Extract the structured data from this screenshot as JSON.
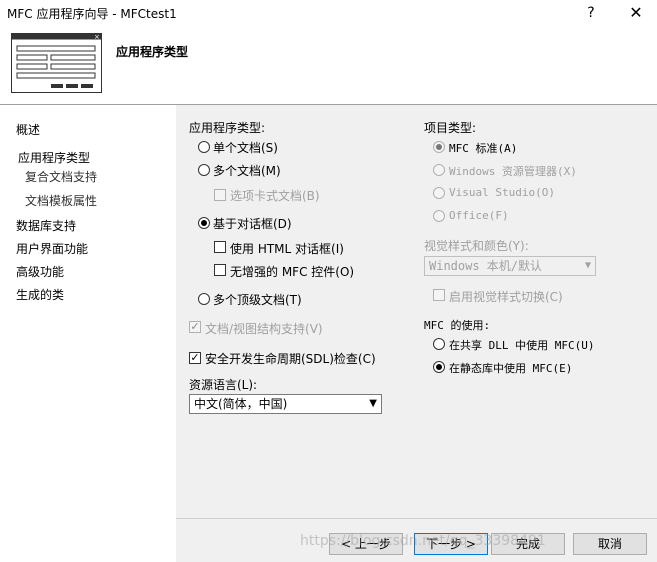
{
  "window": {
    "title": "MFC 应用程序向导 - MFCtest1",
    "help": "?",
    "close": "✕"
  },
  "header": {
    "title": "应用程序类型"
  },
  "nav": {
    "items": [
      {
        "label": "概述"
      },
      {
        "label": "应用程序类型"
      },
      {
        "label": "复合文档支持"
      },
      {
        "label": "文档模板属性"
      },
      {
        "label": "数据库支持"
      },
      {
        "label": "用户界面功能"
      },
      {
        "label": "高级功能"
      },
      {
        "label": "生成的类"
      }
    ]
  },
  "app_type": {
    "label": "应用程序类型:",
    "single_doc": "单个文档(S)",
    "multi_doc": "多个文档(M)",
    "tabbed_docs": "选项卡式文档(B)",
    "dialog_based": "基于对话框(D)",
    "use_html_dialog": "使用 HTML 对话框(I)",
    "no_enhanced_mfc": "无增强的 MFC 控件(O)",
    "multi_top_level": "多个顶级文档(T)",
    "doc_view": "文档/视图结构支持(V)",
    "sdl_check": "安全开发生命周期(SDL)检查(C)",
    "resource_language_label": "资源语言(L):",
    "resource_language_value": "中文(简体，中国)"
  },
  "project_type": {
    "label": "项目类型:",
    "mfc_standard": "MFC 标准(A)",
    "windows_explorer": "Windows 资源管理器(X)",
    "visual_studio": "Visual Studio(O)",
    "office": "Office(F)",
    "visual_style_label": "视觉样式和颜色(Y):",
    "visual_style_value": "Windows 本机/默认",
    "enable_style_switch": "启用视觉样式切换(C)"
  },
  "mfc_use": {
    "label": "MFC 的使用:",
    "shared_dll": "在共享 DLL 中使用 MFC(U)",
    "static_lib": "在静态库中使用 MFC(E)"
  },
  "buttons": {
    "prev": "< 上一步",
    "next": "下一步 >",
    "finish": "完成",
    "cancel": "取消"
  },
  "watermark": "https://blog.csdn.net/qq_33398491",
  "colors": {
    "content_bg": "#f0f0f0",
    "focus_border": "#0078d7",
    "disabled_text": "#a0a0a0"
  }
}
